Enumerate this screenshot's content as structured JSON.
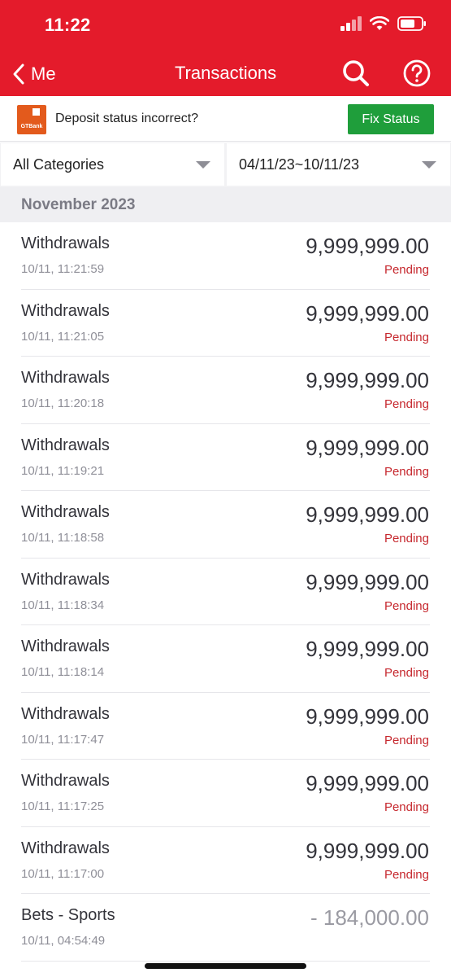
{
  "status_bar": {
    "time": "11:22"
  },
  "nav": {
    "back_label": "Me",
    "title": "Transactions"
  },
  "banner": {
    "bank_logo_text": "GTBank",
    "message": "Deposit status incorrect?",
    "button_label": "Fix Status"
  },
  "filters": {
    "category": "All Categories",
    "date_range": "04/11/23~10/11/23"
  },
  "section": {
    "title": "November 2023"
  },
  "transactions": [
    {
      "title": "Withdrawals",
      "time": "10/11, 11:21:59",
      "amount": "9,999,999.00",
      "status": "Pending"
    },
    {
      "title": "Withdrawals",
      "time": "10/11, 11:21:05",
      "amount": "9,999,999.00",
      "status": "Pending"
    },
    {
      "title": "Withdrawals",
      "time": "10/11, 11:20:18",
      "amount": "9,999,999.00",
      "status": "Pending"
    },
    {
      "title": "Withdrawals",
      "time": "10/11, 11:19:21",
      "amount": "9,999,999.00",
      "status": "Pending"
    },
    {
      "title": "Withdrawals",
      "time": "10/11, 11:18:58",
      "amount": "9,999,999.00",
      "status": "Pending"
    },
    {
      "title": "Withdrawals",
      "time": "10/11, 11:18:34",
      "amount": "9,999,999.00",
      "status": "Pending"
    },
    {
      "title": "Withdrawals",
      "time": "10/11, 11:18:14",
      "amount": "9,999,999.00",
      "status": "Pending"
    },
    {
      "title": "Withdrawals",
      "time": "10/11, 11:17:47",
      "amount": "9,999,999.00",
      "status": "Pending"
    },
    {
      "title": "Withdrawals",
      "time": "10/11, 11:17:25",
      "amount": "9,999,999.00",
      "status": "Pending"
    },
    {
      "title": "Withdrawals",
      "time": "10/11, 11:17:00",
      "amount": "9,999,999.00",
      "status": "Pending"
    },
    {
      "title": "Bets - Sports",
      "time": "10/11, 04:54:49",
      "amount": "- 184,000.00",
      "status": ""
    }
  ],
  "colors": {
    "brand_red": "#e41b2b",
    "fix_green": "#1f9e3b",
    "pending_red": "#c6282e",
    "gtbank_orange": "#e35a1c"
  },
  "icons": {
    "back": "chevron-left-icon",
    "search": "search-icon",
    "help": "help-circle-icon",
    "signal": "signal-icon",
    "wifi": "wifi-icon",
    "battery": "battery-icon",
    "dropdown": "caret-down-icon"
  }
}
